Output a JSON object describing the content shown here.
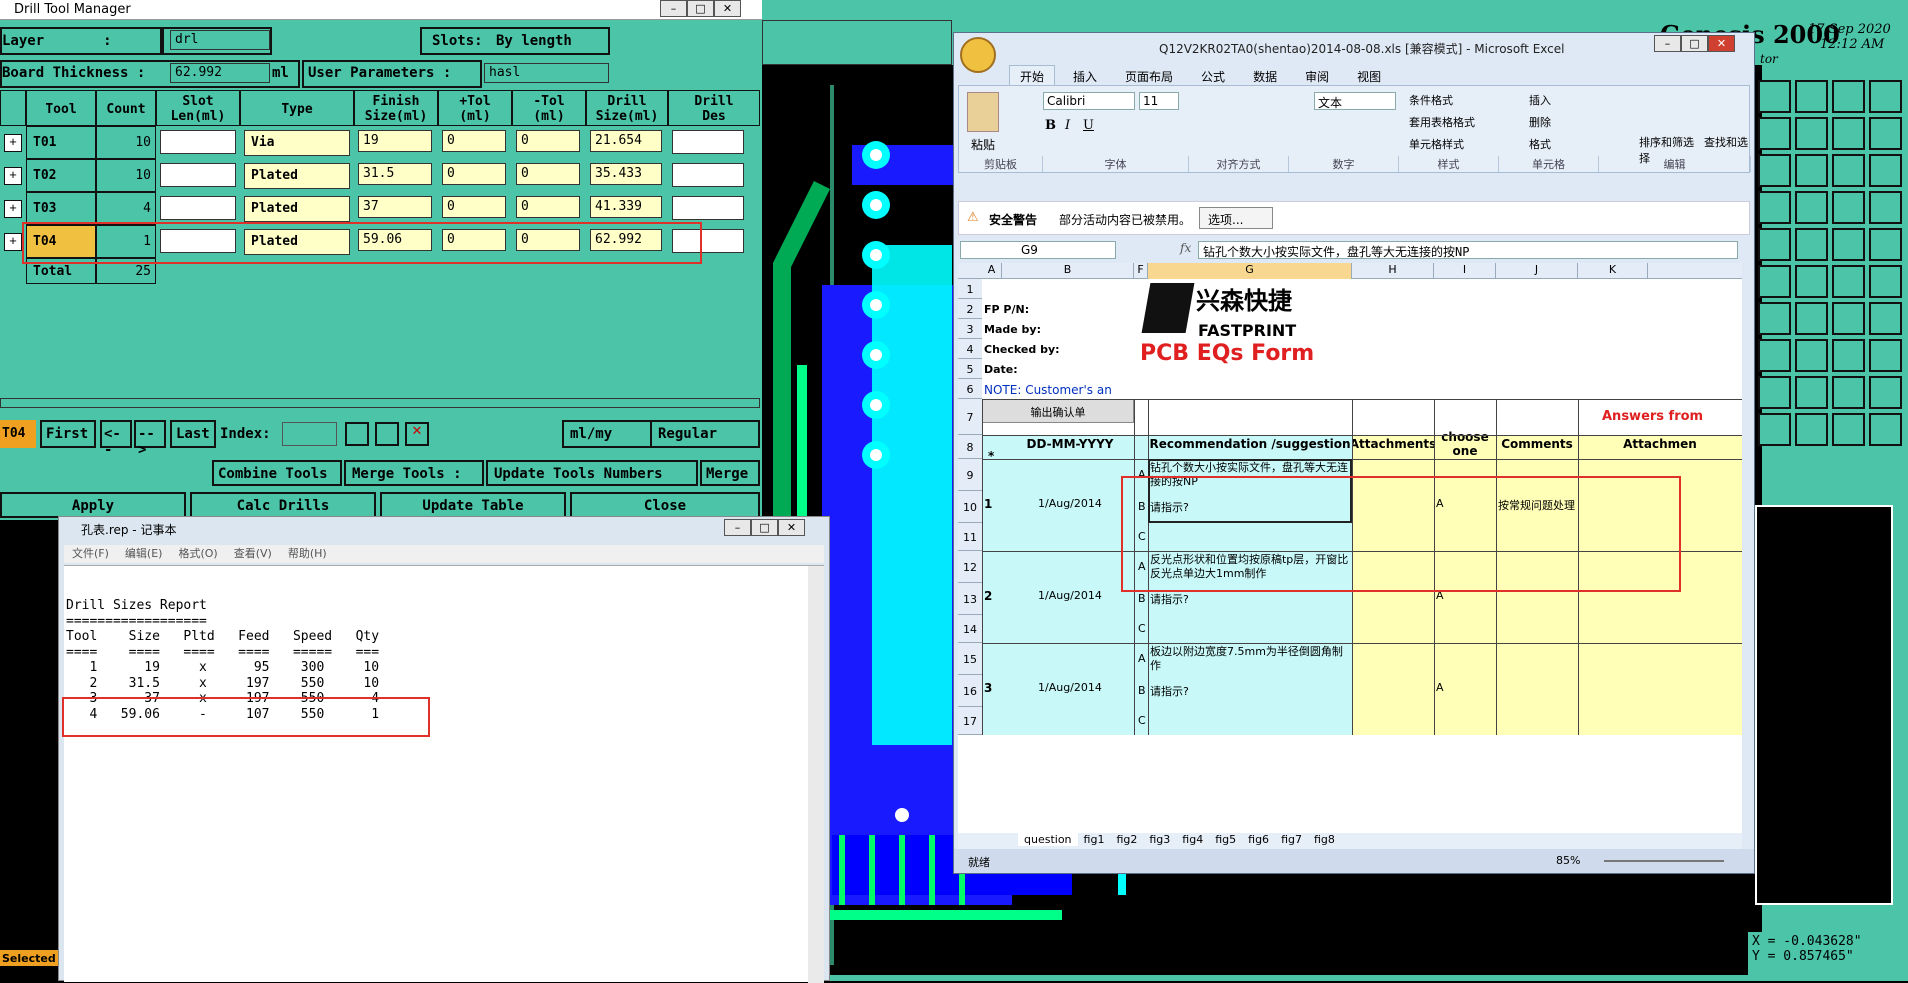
{
  "drill": {
    "title": "Drill Tool Manager",
    "layer_label": "Layer       :",
    "layer_value": "drl",
    "slots_label": "Slots:",
    "slots_value": "By length",
    "thick_label": "Board Thickness :",
    "thick_value": "62.992",
    "thick_unit": "ml",
    "user_params_label": "User Parameters :",
    "user_params_value": "hasl",
    "headers": [
      "Tool",
      "Count",
      "Slot\nLen(ml)",
      "Type",
      "Finish\nSize(ml)",
      "+Tol\n(ml)",
      "-Tol\n(ml)",
      "Drill\nSize(ml)",
      "Drill\nDes"
    ],
    "rows": [
      {
        "tool": "T01",
        "count": "10",
        "type": "Via",
        "finish": "19",
        "ptol": "0",
        "ntol": "0",
        "drill": "21.654"
      },
      {
        "tool": "T02",
        "count": "10",
        "type": "Plated",
        "finish": "31.5",
        "ptol": "0",
        "ntol": "0",
        "drill": "35.433"
      },
      {
        "tool": "T03",
        "count": "4",
        "type": "Plated",
        "finish": "37",
        "ptol": "0",
        "ntol": "0",
        "drill": "41.339"
      },
      {
        "tool": "T04",
        "count": "1",
        "type": "Plated",
        "finish": "59.06",
        "ptol": "0",
        "ntol": "0",
        "drill": "62.992"
      }
    ],
    "total_label": "Total",
    "total_value": "25",
    "nav_current": "T04",
    "first": "First",
    "prev": "<--",
    "next": "-->",
    "last": "Last",
    "index_label": "Index:",
    "unit_sel": "ml/my",
    "plated_sel": "Regular",
    "combine": "Combine Tools",
    "merge_label": "Merge Tools :",
    "update_nums": "Update Tools Numbers",
    "merge": "Merge",
    "apply": "Apply",
    "calc": "Calc Drills",
    "update_table": "Update Table",
    "close": "Close"
  },
  "notepad": {
    "title": "孔表.rep - 记事本",
    "menus": [
      "文件(F)",
      "编辑(E)",
      "格式(O)",
      "查看(V)",
      "帮助(H)"
    ],
    "lines": [
      "Drill Sizes Report",
      "==================",
      "Tool    Size   Pltd   Feed   Speed   Qty",
      "====    ====   ====   ====   =====   ===",
      "   1      19     x      95    300     10",
      "   2    31.5     x     197    550     10",
      "   3      37     x     197    550      4",
      "   4   59.06     -     107    550      1"
    ]
  },
  "excel": {
    "title": "Q12V2KR02TA0(shentao)2014-08-08.xls  [兼容模式] - Microsoft Excel",
    "ribbon_tabs": [
      "开始",
      "插入",
      "页面布局",
      "公式",
      "数据",
      "审阅",
      "视图"
    ],
    "groups": [
      "剪贴板",
      "字体",
      "对齐方式",
      "数字",
      "样式",
      "单元格",
      "编辑"
    ],
    "paste": "粘贴",
    "font": "Calibri",
    "size": "11",
    "numfmt": "文本",
    "style_items": [
      "条件格式",
      "套用表格格式",
      "单元格样式"
    ],
    "cell_items": [
      "插入",
      "删除",
      "格式"
    ],
    "edit_items": [
      "排序和筛选",
      "查找和选择"
    ],
    "security_title": "安全警告",
    "security_msg": "部分活动内容已被禁用。",
    "options": "选项...",
    "namebox": "G9",
    "fx": "fx",
    "formula": "钻孔个数大小按实际文件，盘孔等大无连接的按NP",
    "cols": [
      "A",
      "B",
      "F",
      "G",
      "H",
      "I",
      "J",
      "K"
    ],
    "rows": [
      "1",
      "2",
      "3",
      "4",
      "5",
      "6",
      "7",
      "8",
      "9",
      "10",
      "11",
      "12",
      "13",
      "14",
      "15",
      "16",
      "17"
    ],
    "fp_pn": "FP P/N:",
    "made_by": "Made by:",
    "checked_by": "Checked by:",
    "date": "Date:",
    "note": "NOTE: Customer's  an",
    "logo_cn": "兴森快捷",
    "logo_en": "FASTPRINT",
    "form_title": "PCB EQs Form",
    "out_confirm": "输出确认单",
    "answers": "Answers from",
    "hdr_date": "DD-MM-YYYY",
    "hdr_rec": "Recommendation /suggestion",
    "hdr_att": "Attachments",
    "hdr_pls": "Pls choose one option",
    "hdr_com": "Comments",
    "hdr_att2": "Attachmen",
    "star": "*",
    "q": [
      {
        "n": "1",
        "d": "1/Aug/2014",
        "a": "钻孔个数大小按实际文件，盘孔等大无连接的按NP",
        "b": "请指示?",
        "opt": "A",
        "com": "按常规问题处理"
      },
      {
        "n": "2",
        "d": "1/Aug/2014",
        "a": "反光点形状和位置均按原稿tp层，开窗比反光点单边大1mm制作",
        "b": "请指示?",
        "opt": "A",
        "com": ""
      },
      {
        "n": "3",
        "d": "1/Aug/2014",
        "a": "板边以附边宽度7.5mm为半径倒圆角制作",
        "b": "请指示?",
        "opt": "A",
        "com": ""
      }
    ],
    "sheets": [
      "question",
      "fig1",
      "fig2",
      "fig3",
      "fig4",
      "fig5",
      "fig6",
      "fig7",
      "fig8"
    ],
    "status": "就绪",
    "zoom": "85%"
  },
  "genesis": {
    "title": "Genesis 2000",
    "date": "17 Sep 2020",
    "time": "12:12 AM",
    "tor": "tor",
    "x": "X = -0.043628\"",
    "y": "Y = 0.857465\"",
    "selected": "Selected"
  }
}
